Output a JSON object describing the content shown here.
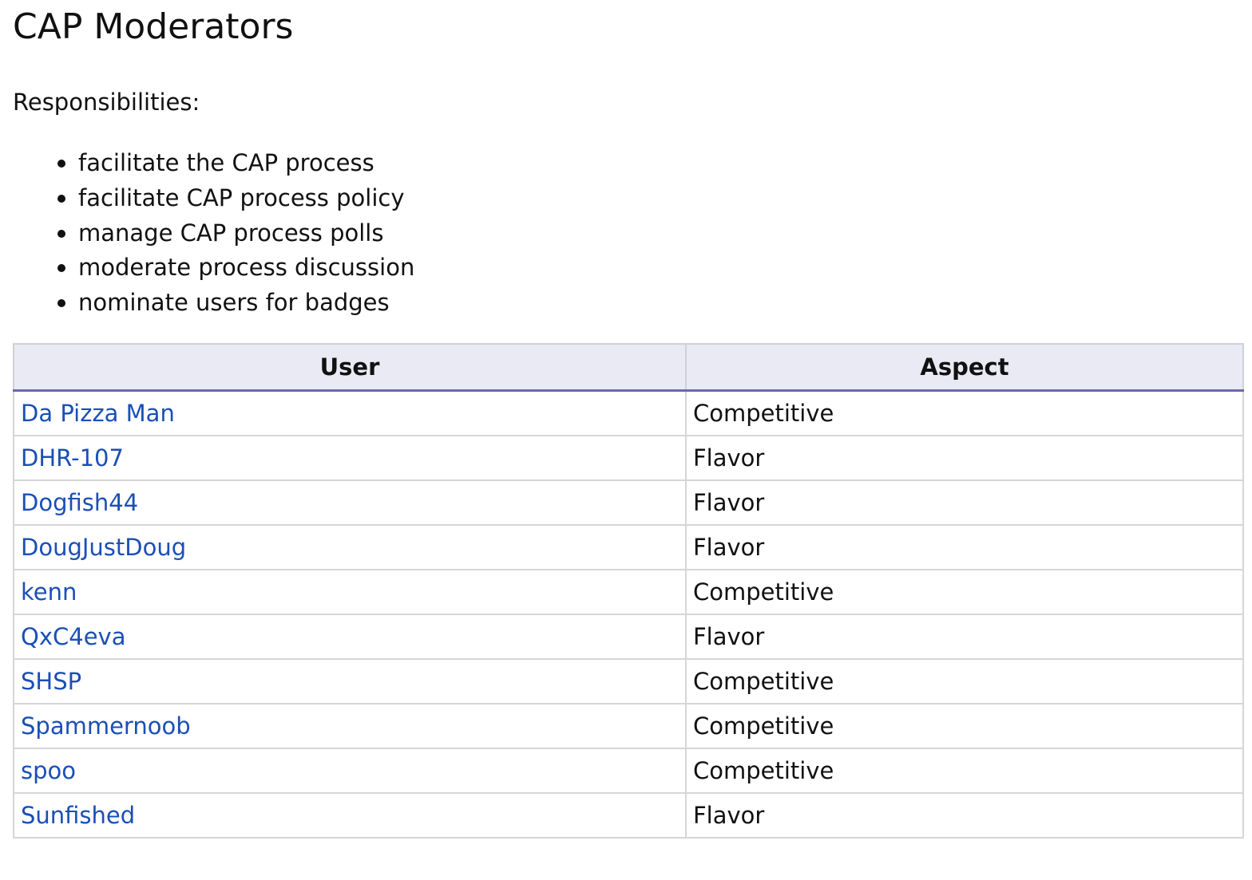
{
  "page": {
    "title": "CAP Moderators",
    "responsibilities_label": "Responsibilities:",
    "responsibilities": [
      "facilitate the CAP process",
      "facilitate CAP process policy",
      "manage CAP process polls",
      "moderate process discussion",
      "nominate users for badges"
    ]
  },
  "table": {
    "headers": [
      "User",
      "Aspect"
    ],
    "rows": [
      {
        "user": "Da Pizza Man",
        "aspect": "Competitive"
      },
      {
        "user": "DHR-107",
        "aspect": "Flavor"
      },
      {
        "user": "Dogfish44",
        "aspect": "Flavor"
      },
      {
        "user": "DougJustDoug",
        "aspect": "Flavor"
      },
      {
        "user": "kenn",
        "aspect": "Competitive"
      },
      {
        "user": "QxC4eva",
        "aspect": "Flavor"
      },
      {
        "user": "SHSP",
        "aspect": "Competitive"
      },
      {
        "user": "Spammernoob",
        "aspect": "Competitive"
      },
      {
        "user": "spoo",
        "aspect": "Competitive"
      },
      {
        "user": "Sunfished",
        "aspect": "Flavor"
      }
    ]
  },
  "colors": {
    "link": "#1a4fb5",
    "header_bg": "#eaeaf5",
    "header_border": "#6a6aaa"
  }
}
